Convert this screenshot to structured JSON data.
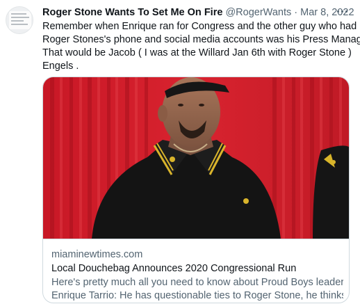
{
  "tweet": {
    "author_name": "Roger Stone Wants To Set Me On Fire",
    "handle": "@RogerWants",
    "separator": "·",
    "date": "Mar 8, 2022",
    "text_lines": [
      "Remember when Enrique ran for Congress and the other guy who had",
      "Roger Stones's phone and social media accounts was his Press Manager.",
      "That would be Jacob ( I was at the Willard Jan 6th with Roger Stone )",
      "Engels ."
    ]
  },
  "card": {
    "domain": "miaminewtimes.com",
    "title": "Local Douchebag Announces 2020 Congressional Run",
    "description_lines": [
      "Here's pretty much all you need to know about Proud Boys leader",
      "Enrique Tarrio: He has questionable ties to Roger Stone, he thinks it'..."
    ],
    "image_icon": "photo-man-in-black-polo-red-background"
  },
  "icons": {
    "more": "more-horizontal-icon",
    "avatar": "avatar-image"
  },
  "colors": {
    "text_primary": "#0f1419",
    "text_secondary": "#536471",
    "border": "#cfd9de",
    "image_bg_red": "#d0202c"
  }
}
